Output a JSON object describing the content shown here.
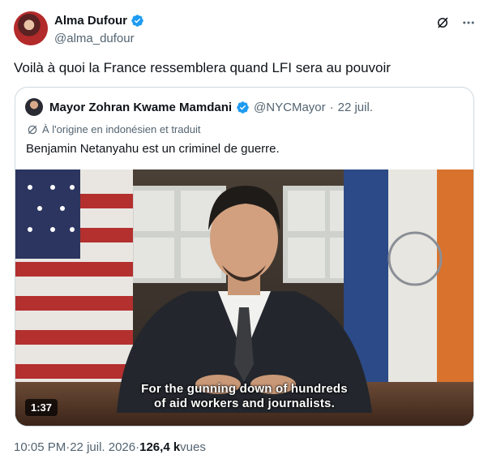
{
  "author": {
    "display_name": "Alma Dufour",
    "handle": "@alma_dufour"
  },
  "tweet": {
    "text": "Voilà à quoi la France ressemblera quand LFI sera au pouvoir"
  },
  "quoted": {
    "display_name": "Mayor Zohran Kwame Mamdani",
    "handle": "@NYCMayor",
    "separator": "·",
    "date": "22 juil.",
    "translation_note": "À l'origine en indonésien et traduit",
    "text": "Benjamin Netanyahu est un criminel de guerre.",
    "video": {
      "subtitle_line1": "For the gunning down of hundreds",
      "subtitle_line2": "of aid workers and journalists.",
      "duration": "1:37"
    }
  },
  "meta": {
    "time": "10:05 PM",
    "separator": " · ",
    "date": "22 juil. 2026",
    "separator2": " · ",
    "views_count": "126,4 k",
    "views_label": " vues"
  },
  "icons": {
    "verified": "verified-badge-icon",
    "grok": "grok-icon",
    "more": "more-icon",
    "translate": "translate-icon"
  },
  "colors": {
    "verified": "#1d9bf0",
    "secondary_text": "#536471",
    "border": "#cfd9de"
  }
}
